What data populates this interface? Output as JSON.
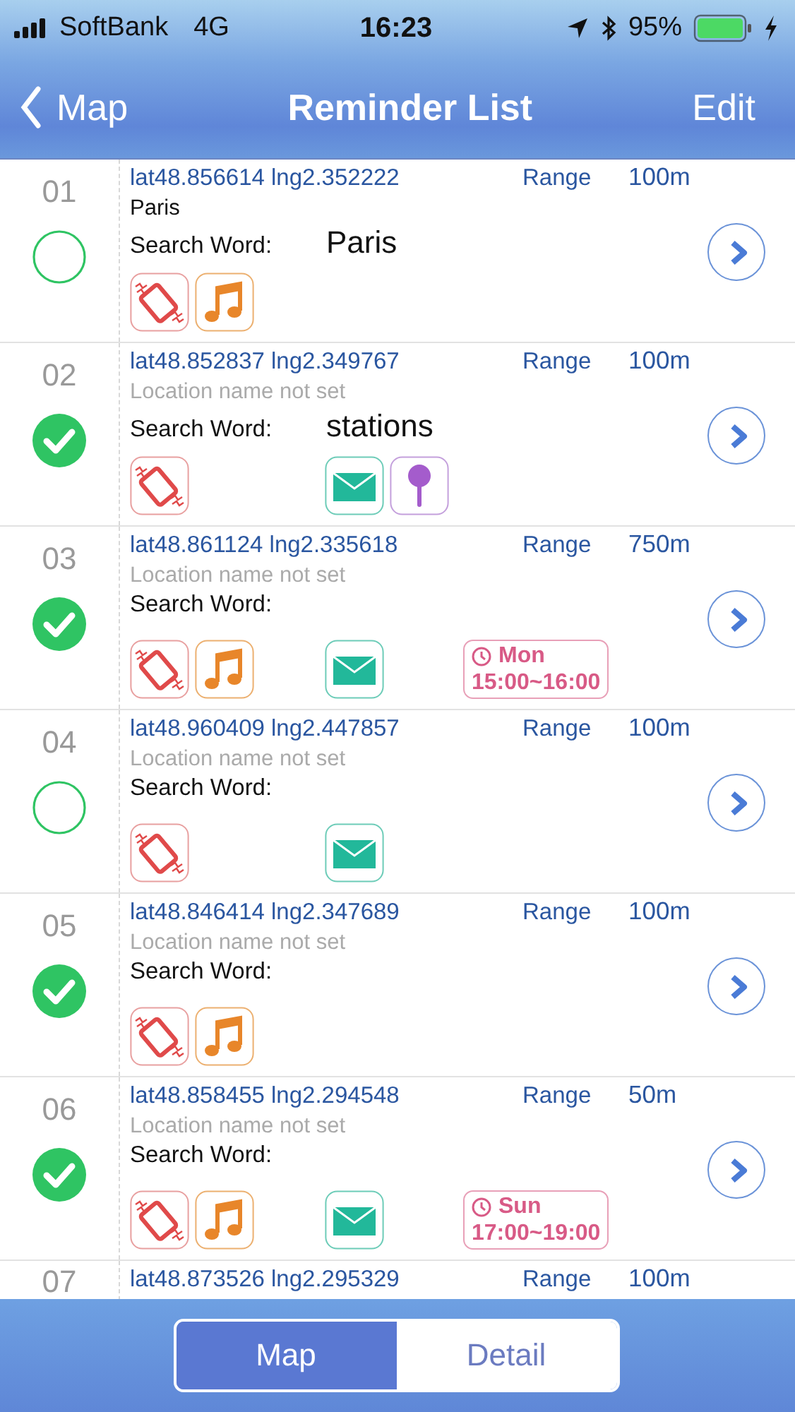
{
  "status_bar": {
    "carrier": "SoftBank",
    "network": "4G",
    "time": "16:23",
    "battery": "95%"
  },
  "nav": {
    "back": "Map",
    "title": "Reminder List",
    "action": "Edit"
  },
  "reminders": [
    {
      "number": "01",
      "checked": false,
      "coordinates": "lat48.856614 lng2.352222",
      "range_label": "Range",
      "range": "100m",
      "location": "Paris",
      "location_set": true,
      "search_label": "Search Word:",
      "search_word": "Paris",
      "vibrate": true,
      "sound": true,
      "mail": false,
      "pin": false
    },
    {
      "number": "02",
      "checked": true,
      "coordinates": "lat48.852837 lng2.349767",
      "range_label": "Range",
      "range": "100m",
      "location": "Location name not set",
      "location_set": false,
      "search_label": "Search Word:",
      "search_word": "stations",
      "vibrate": true,
      "sound": false,
      "mail": true,
      "pin": true
    },
    {
      "number": "03",
      "checked": true,
      "coordinates": "lat48.861124 lng2.335618",
      "range_label": "Range",
      "range": "750m",
      "location": "Location name not set",
      "location_set": false,
      "search_label": "Search Word:",
      "vibrate": true,
      "sound": true,
      "mail": true,
      "pin": false,
      "schedule": {
        "day": "Mon",
        "time": "15:00~16:00"
      }
    },
    {
      "number": "04",
      "checked": false,
      "coordinates": "lat48.960409 lng2.447857",
      "range_label": "Range",
      "range": "100m",
      "location": "Location name not set",
      "location_set": false,
      "search_label": "Search Word:",
      "vibrate": true,
      "sound": false,
      "mail": true,
      "pin": false
    },
    {
      "number": "05",
      "checked": true,
      "coordinates": "lat48.846414 lng2.347689",
      "range_label": "Range",
      "range": "100m",
      "location": "Location name not set",
      "location_set": false,
      "search_label": "Search Word:",
      "vibrate": true,
      "sound": true,
      "mail": false,
      "pin": false
    },
    {
      "number": "06",
      "checked": true,
      "coordinates": "lat48.858455 lng2.294548",
      "range_label": "Range",
      "range": "50m",
      "location": "Location name not set",
      "location_set": false,
      "search_label": "Search Word:",
      "vibrate": true,
      "sound": true,
      "mail": true,
      "pin": false,
      "schedule": {
        "day": "Sun",
        "time": "17:00~19:00"
      }
    },
    {
      "kind": "partial",
      "number": "07",
      "coordinates": "lat48.873526 lng2.295329",
      "range_label": "Range",
      "range": "100m"
    }
  ],
  "bottom_tabs": [
    {
      "label": "Map",
      "selected": true
    },
    {
      "label": "Detail",
      "selected": false
    }
  ]
}
